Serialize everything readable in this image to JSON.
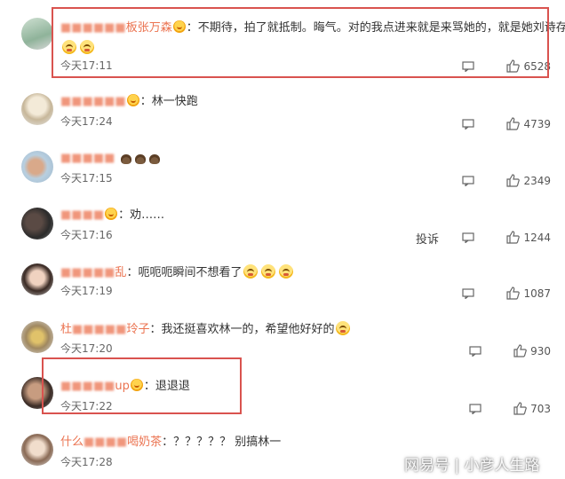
{
  "comments": [
    {
      "user": "板张万森",
      "text": "：不期待，拍了就抵制。晦气。对的我点进来就是来骂她的，就是她刘诗存",
      "time": "今天17:11",
      "likes": "6528"
    },
    {
      "user": "",
      "text": "：林一快跑",
      "time": "今天17:24",
      "likes": "4739"
    },
    {
      "user": "",
      "text": "",
      "time": "今天17:15",
      "likes": "2349"
    },
    {
      "user": "",
      "text": "：劝……",
      "time": "今天17:16",
      "likes": "1244",
      "report_label": "投诉"
    },
    {
      "user": "乱",
      "text": "：呃呃呃瞬间不想看了",
      "time": "今天17:19",
      "likes": "1087"
    },
    {
      "user": "杜",
      "user2": "玲子",
      "text": "：我还挺喜欢林一的，希望他好好的",
      "time": "今天17:20",
      "likes": "930"
    },
    {
      "user": "up",
      "text": "：退退退",
      "time": "今天17:22",
      "likes": "703"
    },
    {
      "user": "什么",
      "user2": "喝奶茶",
      "text": "：？？？？？ 别搞林一",
      "time": "今天17:28",
      "likes": ""
    }
  ],
  "watermark": "网易号 | 小彦人生路",
  "colors": {
    "username": "#eb7350",
    "highlight_border": "#d9534f",
    "text": "#333333",
    "meta": "#666666"
  },
  "icons": {
    "reply": "comment-icon",
    "like": "thumbs-up-icon",
    "badge": "vip-badge-icon",
    "emoji": "emoji-icon"
  }
}
